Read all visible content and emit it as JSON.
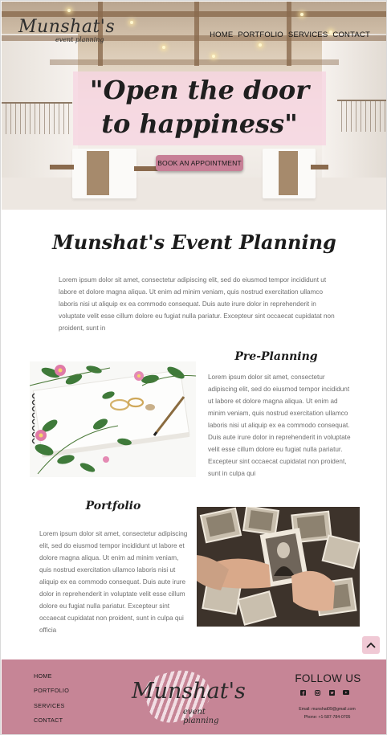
{
  "brand": {
    "name": "Munshat's",
    "tagline": "event planning"
  },
  "nav": {
    "items": [
      "HOME",
      "PORTFOLIO",
      "SERVICES",
      "CONTACT"
    ]
  },
  "hero": {
    "title": "\"Open the door to happiness\"",
    "cta_label": "BOOK AN APPOINTMENT"
  },
  "intro": {
    "title": "Munshat's Event Planning",
    "text": "Lorem ipsum dolor sit amet, consectetur adipiscing elit, sed do eiusmod tempor incididunt ut labore et dolore magna aliqua. Ut enim ad minim veniam, quis nostrud exercitation ullamco laboris nisi ut aliquip ex ea commodo consequat. Duis aute irure dolor in reprehenderit in voluptate velit esse cillum dolore eu fugiat nulla pariatur. Excepteur sint occaecat cupidatat non proident, sunt in"
  },
  "preplanning": {
    "title": "Pre-Planning",
    "text": "Lorem ipsum dolor sit amet, consectetur adipiscing elit, sed do eiusmod tempor incididunt ut labore et dolore magna aliqua. Ut enim ad minim veniam, quis nostrud exercitation ullamco laboris nisi ut aliquip ex ea commodo consequat. Duis aute irure dolor in reprehenderit in voluptate velit esse cillum dolore eu fugiat nulla pariatur. Excepteur sint occaecat cupidatat non proident, sunt in culpa qui"
  },
  "portfolio": {
    "title": "Portfolio",
    "text": "Lorem ipsum dolor sit amet, consectetur adipiscing elit, sed do eiusmod tempor incididunt ut labore et dolore magna aliqua. Ut enim ad minim veniam, quis nostrud exercitation ullamco laboris nisi ut aliquip ex ea commodo consequat. Duis aute irure dolor in reprehenderit in voluptate velit esse cillum dolore eu fugiat nulla pariatur. Excepteur sint occaecat cupidatat non proident, sunt in culpa qui officia"
  },
  "footer": {
    "nav": [
      "HOME",
      "PORTFOLIO",
      "SERVICES",
      "CONTACT"
    ],
    "follow_title": "FOLLOW US",
    "socials": [
      "facebook-icon",
      "instagram-icon",
      "twitter-icon",
      "youtube-icon"
    ],
    "email": "Email: munshat09@gmail.com",
    "phone": "Phone: +1-587-784-0705"
  },
  "colors": {
    "accent_pink": "#c68596",
    "banner_pink": "#f7d5e2",
    "button_pink": "#c77f96"
  },
  "icons": {
    "to_top": "chevron-up-icon"
  }
}
